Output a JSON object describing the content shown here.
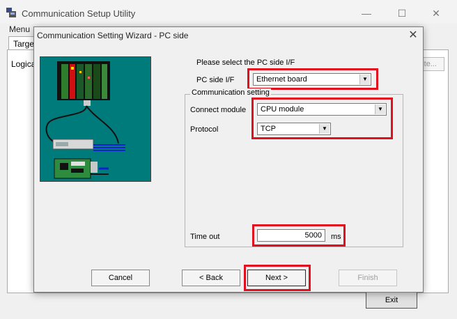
{
  "app": {
    "title": "Communication Setup Utility",
    "menu": [
      "Menu"
    ],
    "tab_label": "Target",
    "logical_label": "Logica",
    "delete_label": "ete...",
    "exit_label": "Exit"
  },
  "window_controls": {
    "minimize": "—",
    "maximize": "☐",
    "close": "✕"
  },
  "dialog": {
    "title": "Communication Setting Wizard - PC side",
    "close_glyph": "✕",
    "prompt": "Please select the PC side I/F",
    "pc_side_if_label": "PC side I/F",
    "pc_side_if_value": "Ethernet board",
    "group_title": "Communication setting",
    "connect_module_label": "Connect module",
    "connect_module_value": "CPU module",
    "protocol_label": "Protocol",
    "protocol_value": "TCP",
    "timeout_label": "Time out",
    "timeout_value": "5000",
    "timeout_unit": "ms",
    "buttons": {
      "cancel": "Cancel",
      "back": "< Back",
      "next": "Next >",
      "finish": "Finish"
    }
  },
  "colors": {
    "highlight": "#e0101e",
    "illustration_bg": "#007b7b"
  }
}
